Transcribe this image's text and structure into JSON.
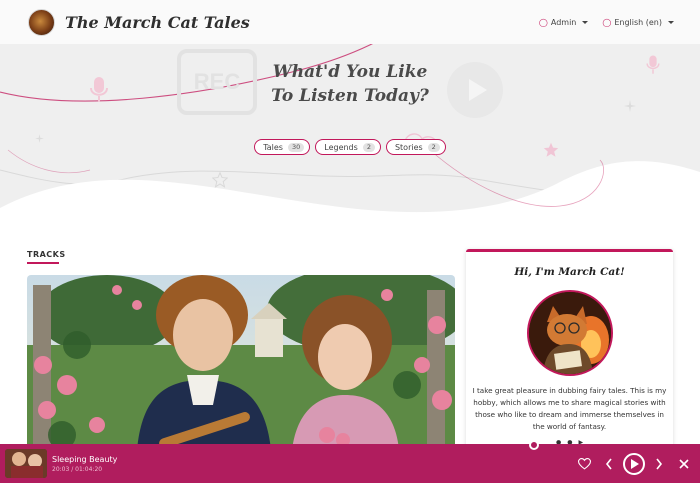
{
  "header": {
    "brand": "The March Cat Tales",
    "admin_label": "Admin",
    "language_label": "English (en)"
  },
  "hero": {
    "title_line1": "What'd You Like",
    "title_line2": "To Listen Today?"
  },
  "filters": [
    {
      "label": "Tales",
      "count": "30"
    },
    {
      "label": "Legends",
      "count": "2"
    },
    {
      "label": "Stories",
      "count": "2"
    }
  ],
  "tracks": {
    "heading": "TRACKS"
  },
  "profile": {
    "title": "Hi, I'm March Cat!",
    "text": "I take great pleasure in dubbing fairy tales. This is my hobby, which allows me to share magical stories with those who like to dream and immerse themselves in the world of fantasy."
  },
  "player": {
    "title": "Sleeping Beauty",
    "time": "20:03 / 01:04:20",
    "progress": 0.31
  },
  "colors": {
    "accent": "#c2185b",
    "player_bg": "#b01d5e"
  },
  "icons": {
    "admin": "user-icon",
    "language": "globe-icon",
    "favorite": "heart-icon",
    "prev": "chevron-left-icon",
    "play": "play-icon",
    "next": "chevron-right-icon",
    "close": "close-icon"
  }
}
